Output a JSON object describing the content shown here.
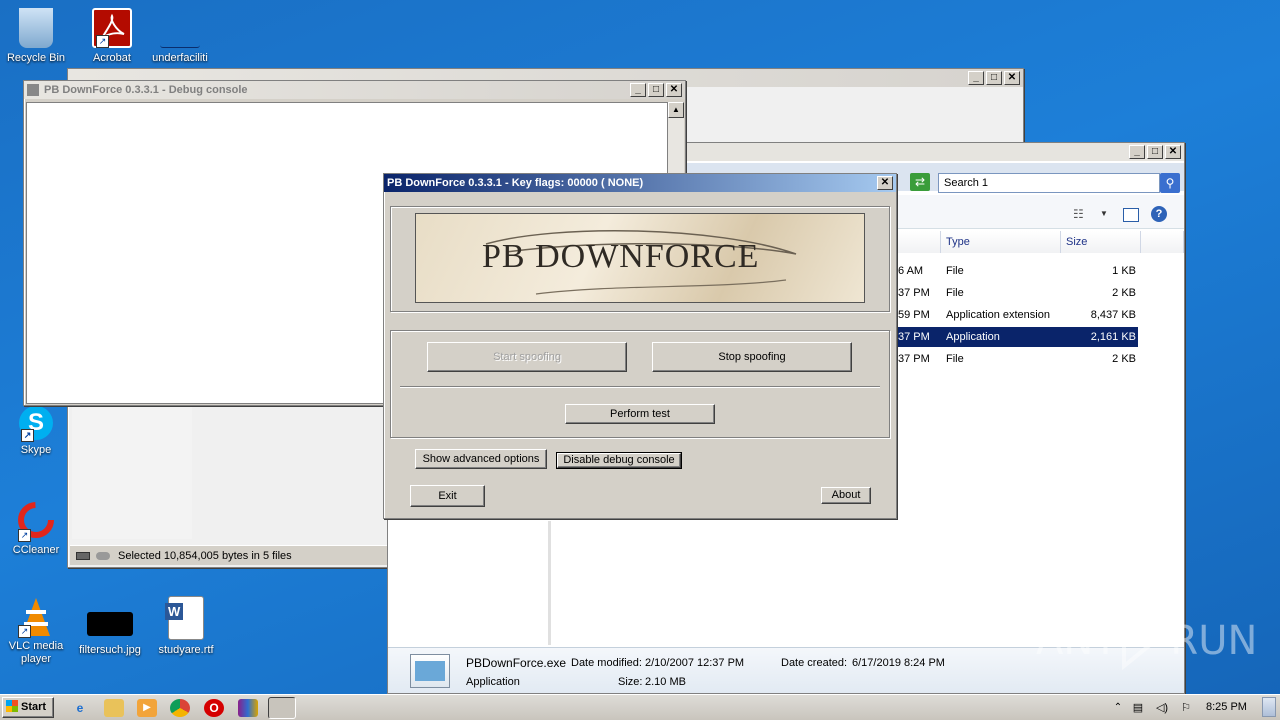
{
  "desktop": {
    "icons": [
      {
        "label": "Recycle Bin"
      },
      {
        "label": "Acrobat"
      },
      {
        "label": "underfaciliti"
      },
      {
        "label": "Skype"
      },
      {
        "label": "CCleaner"
      },
      {
        "label": "VLC media player"
      },
      {
        "label": "filtersuch.jpg"
      },
      {
        "label": "studyare.rtf"
      }
    ]
  },
  "console": {
    "title": "PB DownForce 0.3.3.1  -  Debug console",
    "status_text": "Selected 10,854,005 bytes in 5 files"
  },
  "explorer": {
    "search_placeholder": "Search 1",
    "columns": {
      "type": "Type",
      "size": "Size"
    },
    "rows": [
      {
        "time": "6 AM",
        "type": "File",
        "size": "1 KB"
      },
      {
        "time": "37 PM",
        "type": "File",
        "size": "2 KB"
      },
      {
        "time": "59 PM",
        "type": "Application extension",
        "size": "8,437 KB"
      },
      {
        "time": "37 PM",
        "type": "Application",
        "size": "2,161 KB"
      },
      {
        "time": "37 PM",
        "type": "File",
        "size": "2 KB"
      }
    ],
    "details": {
      "filename": "PBDownForce.exe",
      "modified_label": "Date modified:",
      "modified_value": "2/10/2007 12:37 PM",
      "created_label": "Date created:",
      "created_value": "6/17/2019 8:24 PM",
      "kind": "Application",
      "size_label": "Size:",
      "size_value": "2.10 MB"
    }
  },
  "dialog": {
    "title": "PB DownForce 0.3.3.1  -  Key flags: 00000 ( NONE)",
    "banner_text": "PB DOWNFORCE",
    "start_label": "Start spoofing",
    "stop_label": "Stop spoofing",
    "test_label": "Perform test",
    "advanced_label": "Show advanced options",
    "debug_label": "Disable debug console",
    "exit_label": "Exit",
    "about_label": "About"
  },
  "taskbar": {
    "start_label": "Start",
    "clock": "8:25 PM"
  },
  "watermark": "ANY RUN"
}
